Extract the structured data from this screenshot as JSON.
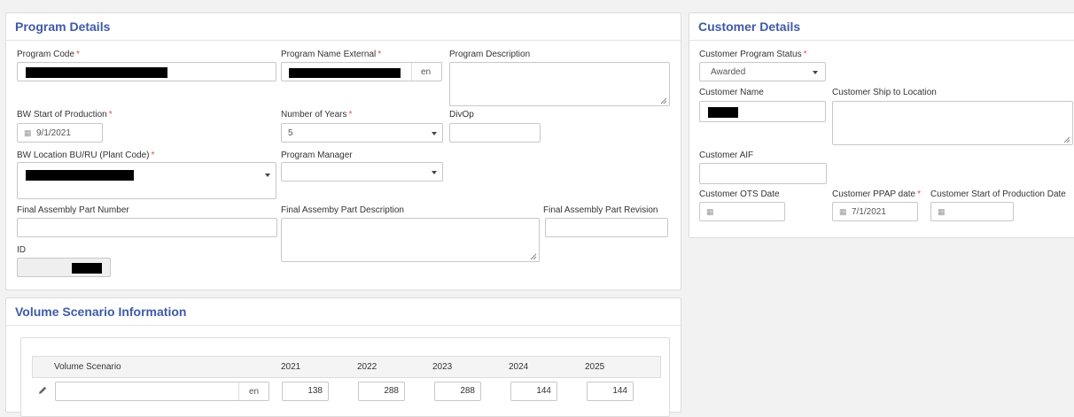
{
  "program_details": {
    "title": "Program Details",
    "program_code": {
      "label": "Program Code",
      "required": "*"
    },
    "program_name_external": {
      "label": "Program Name External",
      "required": "*",
      "lang": "en"
    },
    "program_description": {
      "label": "Program Description"
    },
    "bw_start_of_production": {
      "label": "BW Start of Production",
      "required": "*",
      "value": "9/1/2021"
    },
    "number_of_years": {
      "label": "Number of Years",
      "required": "*",
      "value": "5"
    },
    "divop": {
      "label": "DivOp"
    },
    "bw_location": {
      "label": "BW Location BU/RU (Plant Code)",
      "required": "*"
    },
    "program_manager": {
      "label": "Program Manager"
    },
    "final_assembly_part_number": {
      "label": "Final Assembly Part Number"
    },
    "final_assembly_part_description": {
      "label": "Final Assemby Part Description"
    },
    "final_assembly_part_revision": {
      "label": "Final Assembly Part Revision"
    },
    "id": {
      "label": "ID"
    }
  },
  "customer_details": {
    "title": "Customer Details",
    "customer_program_status": {
      "label": "Customer Program Status",
      "required": "*",
      "value": "Awarded"
    },
    "customer_name": {
      "label": "Customer Name"
    },
    "customer_ship_to_location": {
      "label": "Customer Ship to Location"
    },
    "customer_aif": {
      "label": "Customer AIF"
    },
    "customer_ots_date": {
      "label": "Customer OTS Date"
    },
    "customer_ppap_date": {
      "label": "Customer PPAP date",
      "required": "*",
      "value": "7/1/2021"
    },
    "customer_start_of_production_date": {
      "label": "Customer Start of Production Date"
    }
  },
  "volume_scenario": {
    "title": "Volume Scenario Information",
    "columns": [
      "Volume Scenario",
      "2021",
      "2022",
      "2023",
      "2024",
      "2025"
    ],
    "row": {
      "lang": "en",
      "values": [
        "138",
        "288",
        "288",
        "144",
        "144"
      ]
    }
  },
  "icons": {
    "calendar": "calendar-icon",
    "edit": "pencil-icon",
    "dropdown": "caret-down-icon",
    "resize": "resize-grip-icon"
  },
  "colors": {
    "title": "#3f5aa6",
    "required": "#d9534f",
    "redaction": "#000000"
  }
}
